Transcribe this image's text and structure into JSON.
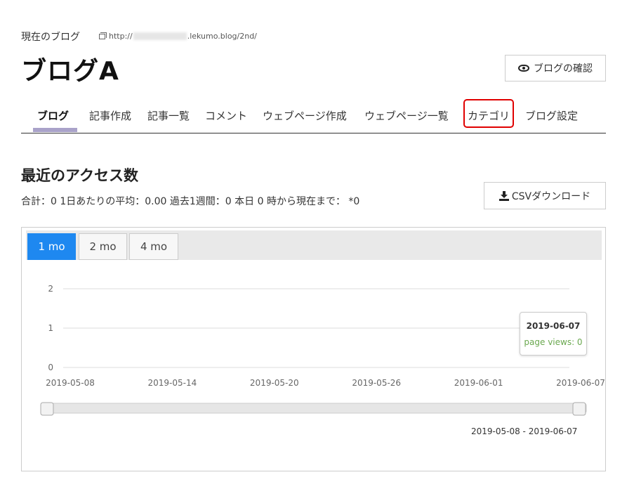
{
  "header": {
    "label": "現在のブログ",
    "url_prefix": "http://",
    "url_suffix": ".lekumo.blog/2nd/",
    "blog_title": "ブログA",
    "view_button": "ブログの確認"
  },
  "nav": {
    "items": [
      {
        "label": "ブログ",
        "active": true
      },
      {
        "label": "記事作成"
      },
      {
        "label": "記事一覧"
      },
      {
        "label": "コメント"
      },
      {
        "label": "ウェブページ作成"
      },
      {
        "label": "ウェブページ一覧"
      },
      {
        "label": "カテゴリ",
        "highlighted": true
      },
      {
        "label": "ブログ設定"
      }
    ],
    "highlight_color": "#e00000"
  },
  "access": {
    "title": "最近のアクセス数",
    "stats": "合計：0 1日あたりの平均：0.00 過去1週間：0 本日 0 時から現在まで： *0",
    "csv_button": "CSVダウンロード"
  },
  "chart": {
    "tabs": [
      "1 mo",
      "2 mo",
      "4 mo"
    ],
    "active_tab": 0,
    "tooltip": {
      "date": "2019-06-07",
      "value": "page views: 0"
    },
    "range_text": "2019-05-08 - 2019-06-07",
    "accent": "#1e88f0"
  },
  "chart_data": {
    "type": "line",
    "x": [
      "2019-05-08",
      "2019-05-14",
      "2019-05-20",
      "2019-05-26",
      "2019-06-01",
      "2019-06-07"
    ],
    "series": [
      {
        "name": "page views",
        "values": [
          0,
          0,
          0,
          0,
          0,
          0
        ]
      }
    ],
    "yticks": [
      0,
      1,
      2
    ],
    "ylim": [
      0,
      2
    ],
    "grid": true
  }
}
